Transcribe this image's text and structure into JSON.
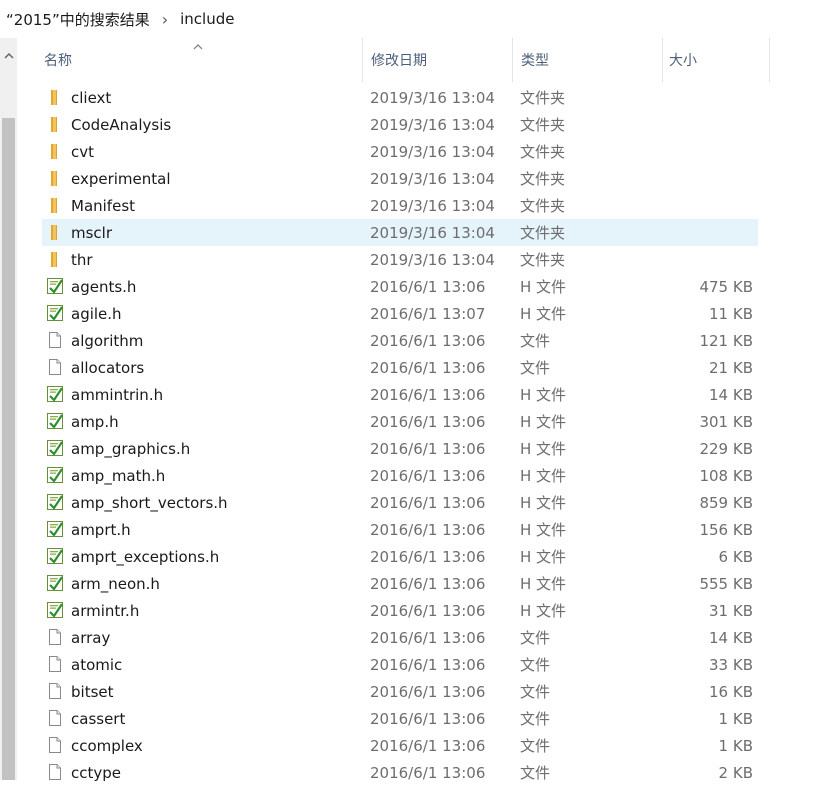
{
  "breadcrumb": {
    "search": "“2015”中的搜索结果",
    "folder": "include"
  },
  "columns": {
    "name": "名称",
    "date": "修改日期",
    "type": "类型",
    "size": "大小"
  },
  "selected_row": "mscl",
  "files": [
    {
      "name": "cliext",
      "date": "2019/3/16 13:04",
      "type": "文件夹",
      "size": "",
      "icon": "folder-icon"
    },
    {
      "name": "CodeAnalysis",
      "date": "2019/3/16 13:04",
      "type": "文件夹",
      "size": "",
      "icon": "folder-icon"
    },
    {
      "name": "cvt",
      "date": "2019/3/16 13:04",
      "type": "文件夹",
      "size": "",
      "icon": "folder-icon"
    },
    {
      "name": "experimental",
      "date": "2019/3/16 13:04",
      "type": "文件夹",
      "size": "",
      "icon": "folder-icon"
    },
    {
      "name": "Manifest",
      "date": "2019/3/16 13:04",
      "type": "文件夹",
      "size": "",
      "icon": "folder-icon"
    },
    {
      "name": "msclr",
      "date": "2019/3/16 13:04",
      "type": "文件夹",
      "size": "",
      "icon": "folder-icon"
    },
    {
      "name": "thr",
      "date": "2019/3/16 13:04",
      "type": "文件夹",
      "size": "",
      "icon": "folder-icon"
    },
    {
      "name": "agents.h",
      "date": "2016/6/1 13:06",
      "type": "H 文件",
      "size": "475 KB",
      "icon": "header-file-icon"
    },
    {
      "name": "agile.h",
      "date": "2016/6/1 13:07",
      "type": "H 文件",
      "size": "11 KB",
      "icon": "header-file-icon"
    },
    {
      "name": "algorithm",
      "date": "2016/6/1 13:06",
      "type": "文件",
      "size": "121 KB",
      "icon": "file-icon"
    },
    {
      "name": "allocators",
      "date": "2016/6/1 13:06",
      "type": "文件",
      "size": "21 KB",
      "icon": "file-icon"
    },
    {
      "name": "ammintrin.h",
      "date": "2016/6/1 13:06",
      "type": "H 文件",
      "size": "14 KB",
      "icon": "header-file-icon"
    },
    {
      "name": "amp.h",
      "date": "2016/6/1 13:06",
      "type": "H 文件",
      "size": "301 KB",
      "icon": "header-file-icon"
    },
    {
      "name": "amp_graphics.h",
      "date": "2016/6/1 13:06",
      "type": "H 文件",
      "size": "229 KB",
      "icon": "header-file-icon"
    },
    {
      "name": "amp_math.h",
      "date": "2016/6/1 13:06",
      "type": "H 文件",
      "size": "108 KB",
      "icon": "header-file-icon"
    },
    {
      "name": "amp_short_vectors.h",
      "date": "2016/6/1 13:06",
      "type": "H 文件",
      "size": "859 KB",
      "icon": "header-file-icon"
    },
    {
      "name": "amprt.h",
      "date": "2016/6/1 13:06",
      "type": "H 文件",
      "size": "156 KB",
      "icon": "header-file-icon"
    },
    {
      "name": "amprt_exceptions.h",
      "date": "2016/6/1 13:06",
      "type": "H 文件",
      "size": "6 KB",
      "icon": "header-file-icon"
    },
    {
      "name": "arm_neon.h",
      "date": "2016/6/1 13:06",
      "type": "H 文件",
      "size": "555 KB",
      "icon": "header-file-icon"
    },
    {
      "name": "armintr.h",
      "date": "2016/6/1 13:06",
      "type": "H 文件",
      "size": "31 KB",
      "icon": "header-file-icon"
    },
    {
      "name": "array",
      "date": "2016/6/1 13:06",
      "type": "文件",
      "size": "14 KB",
      "icon": "file-icon"
    },
    {
      "name": "atomic",
      "date": "2016/6/1 13:06",
      "type": "文件",
      "size": "33 KB",
      "icon": "file-icon"
    },
    {
      "name": "bitset",
      "date": "2016/6/1 13:06",
      "type": "文件",
      "size": "16 KB",
      "icon": "file-icon"
    },
    {
      "name": "cassert",
      "date": "2016/6/1 13:06",
      "type": "文件",
      "size": "1 KB",
      "icon": "file-icon"
    },
    {
      "name": "ccomplex",
      "date": "2016/6/1 13:06",
      "type": "文件",
      "size": "1 KB",
      "icon": "file-icon"
    },
    {
      "name": "cctype",
      "date": "2016/6/1 13:06",
      "type": "文件",
      "size": "2 KB",
      "icon": "file-icon"
    }
  ]
}
